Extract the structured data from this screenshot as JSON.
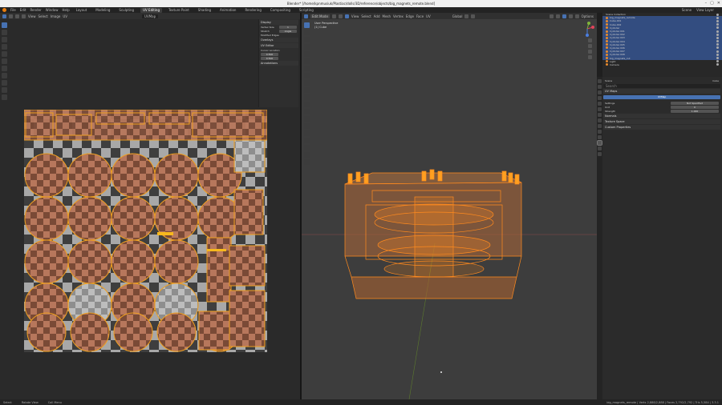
{
  "window": {
    "title": "Blender* [/home/kpnmusiuk/Plastiac/dolls/3D/reference/objects/big_magnets_remote.blend]",
    "controls": [
      "–",
      "▢",
      "✕"
    ]
  },
  "menu": {
    "items": [
      "File",
      "Edit",
      "Render",
      "Window",
      "Help"
    ],
    "workspaces": [
      "Layout",
      "Modeling",
      "Sculpting",
      "UV Editing",
      "Texture Paint",
      "Shading",
      "Animation",
      "Rendering",
      "Compositing",
      "Scripting"
    ],
    "active_workspace": "UV Editing",
    "scene": "Scene",
    "view_layer": "View Layer"
  },
  "uv_editor": {
    "header": [
      "View",
      "Select",
      "Image",
      "UV"
    ],
    "image_name": "UVMap",
    "npanel": {
      "display_label": "Display",
      "stretch_label": "Stretch",
      "modified_edges": "Modified Edges",
      "overlays_label": "Overlays",
      "rows": [
        {
          "label": "Vertex Size",
          "value": "1"
        },
        {
          "label": "Stretch",
          "value": "Angle"
        }
      ],
      "uv_editor_label": "UV Editor",
      "cursor_label": "Cursor Location",
      "cursor_x": "0.500",
      "cursor_y": "0.500",
      "annotations_label": "Annotations"
    }
  },
  "viewport": {
    "header": [
      "View",
      "Select",
      "Add",
      "Mesh",
      "Vertex",
      "Edge",
      "Face",
      "UV"
    ],
    "mode": "Edit Mode",
    "perspective": "User Perspective",
    "collection": "(1) Cube",
    "orientation": "Global",
    "options_label": "Options"
  },
  "outliner": {
    "rows": [
      {
        "label": "Scene Collection",
        "sel": false
      },
      {
        "label": "big_magnets_remote",
        "sel": true
      },
      {
        "label": "Cube.001",
        "sel": true
      },
      {
        "label": "Cube.002",
        "sel": true
      },
      {
        "label": "Cylinder",
        "sel": true
      },
      {
        "label": "Cylinder.001",
        "sel": true
      },
      {
        "label": "Cylinder.002",
        "sel": true
      },
      {
        "label": "Cylinder.003",
        "sel": true
      },
      {
        "label": "Cylinder.004",
        "sel": true
      },
      {
        "label": "Cylinder.005",
        "sel": true
      },
      {
        "label": "Cylinder.006",
        "sel": true
      },
      {
        "label": "Cylinder.007",
        "sel": true
      },
      {
        "label": "Cylinder.008",
        "sel": true
      },
      {
        "label": "big_magnets_cut",
        "sel": true
      },
      {
        "label": "Light",
        "sel": false
      },
      {
        "label": "Camera",
        "sel": false
      }
    ]
  },
  "properties": {
    "tab_title": "Scene",
    "object": "Cube",
    "search": "Search",
    "section_uvmaps": "UV Maps",
    "active_uv": "UVMap",
    "rows": [
      {
        "label": "Settings",
        "value": "Not Specified"
      },
      {
        "label": "Unit",
        "value": "0"
      },
      {
        "label": "Strength",
        "value": "1.000"
      }
    ],
    "collapsed": [
      "Normals",
      "Texture Space",
      "Custom Properties"
    ]
  },
  "status": {
    "select": "Select",
    "box": "Rotate View",
    "menu": "Call Menu",
    "version": "big_magnets_remote | Verts 2,888/2,888 | Faces 2,792/2,792 | Tris 5,584 | 3.3.1"
  }
}
